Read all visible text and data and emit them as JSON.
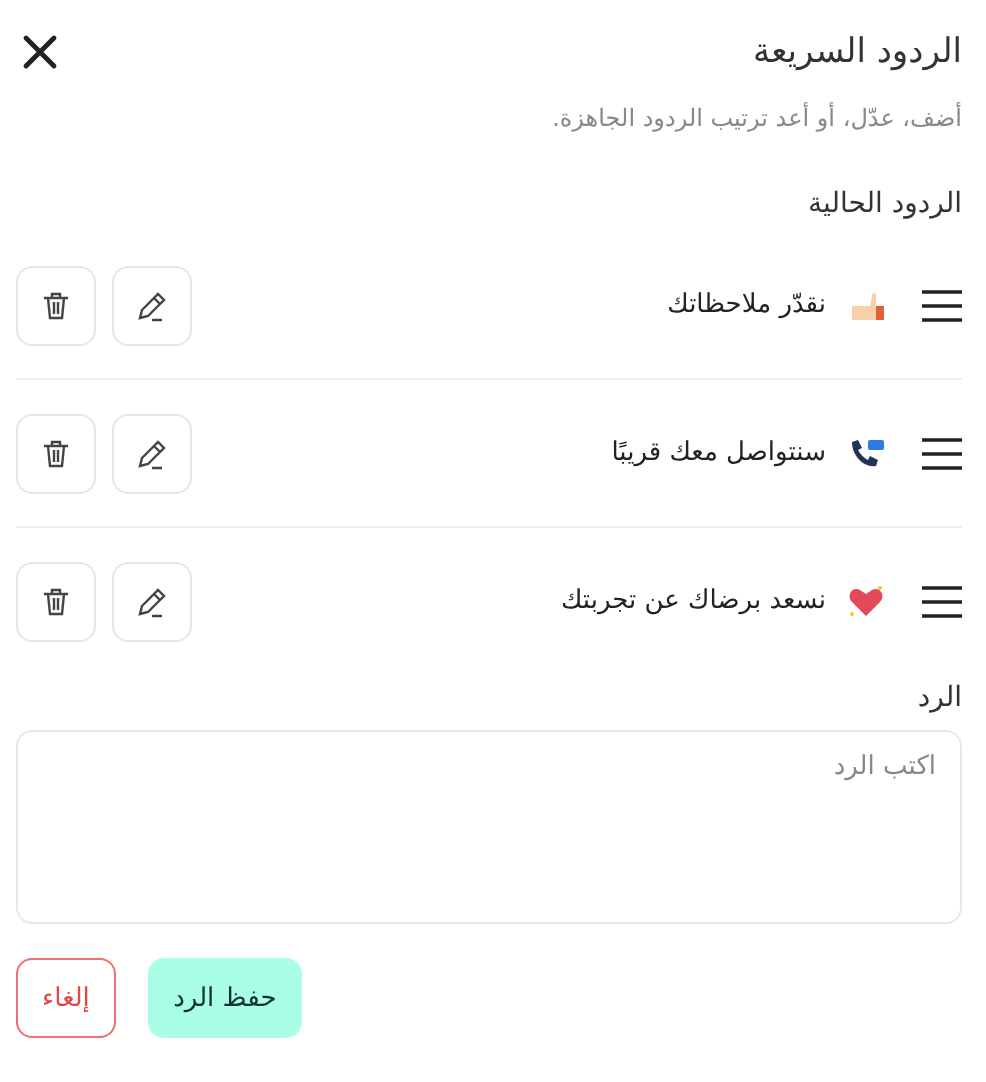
{
  "header": {
    "title": "الردود السريعة",
    "subtitle": "أضف، عدّل، أو أعد ترتيب الردود الجاهزة."
  },
  "section_label": "الردود الحالية",
  "replies": [
    {
      "text": "نقدّر ملاحظاتك",
      "kind": "thumbs"
    },
    {
      "text": "سنتواصل معك قريبًا",
      "kind": "phone"
    },
    {
      "text": "نسعد برضاك عن تجربتك",
      "kind": "heart"
    }
  ],
  "reply_field": {
    "label": "الرد",
    "placeholder": "اكتب الرد"
  },
  "buttons": {
    "save": "حفظ الرد",
    "cancel": "إلغاء"
  }
}
